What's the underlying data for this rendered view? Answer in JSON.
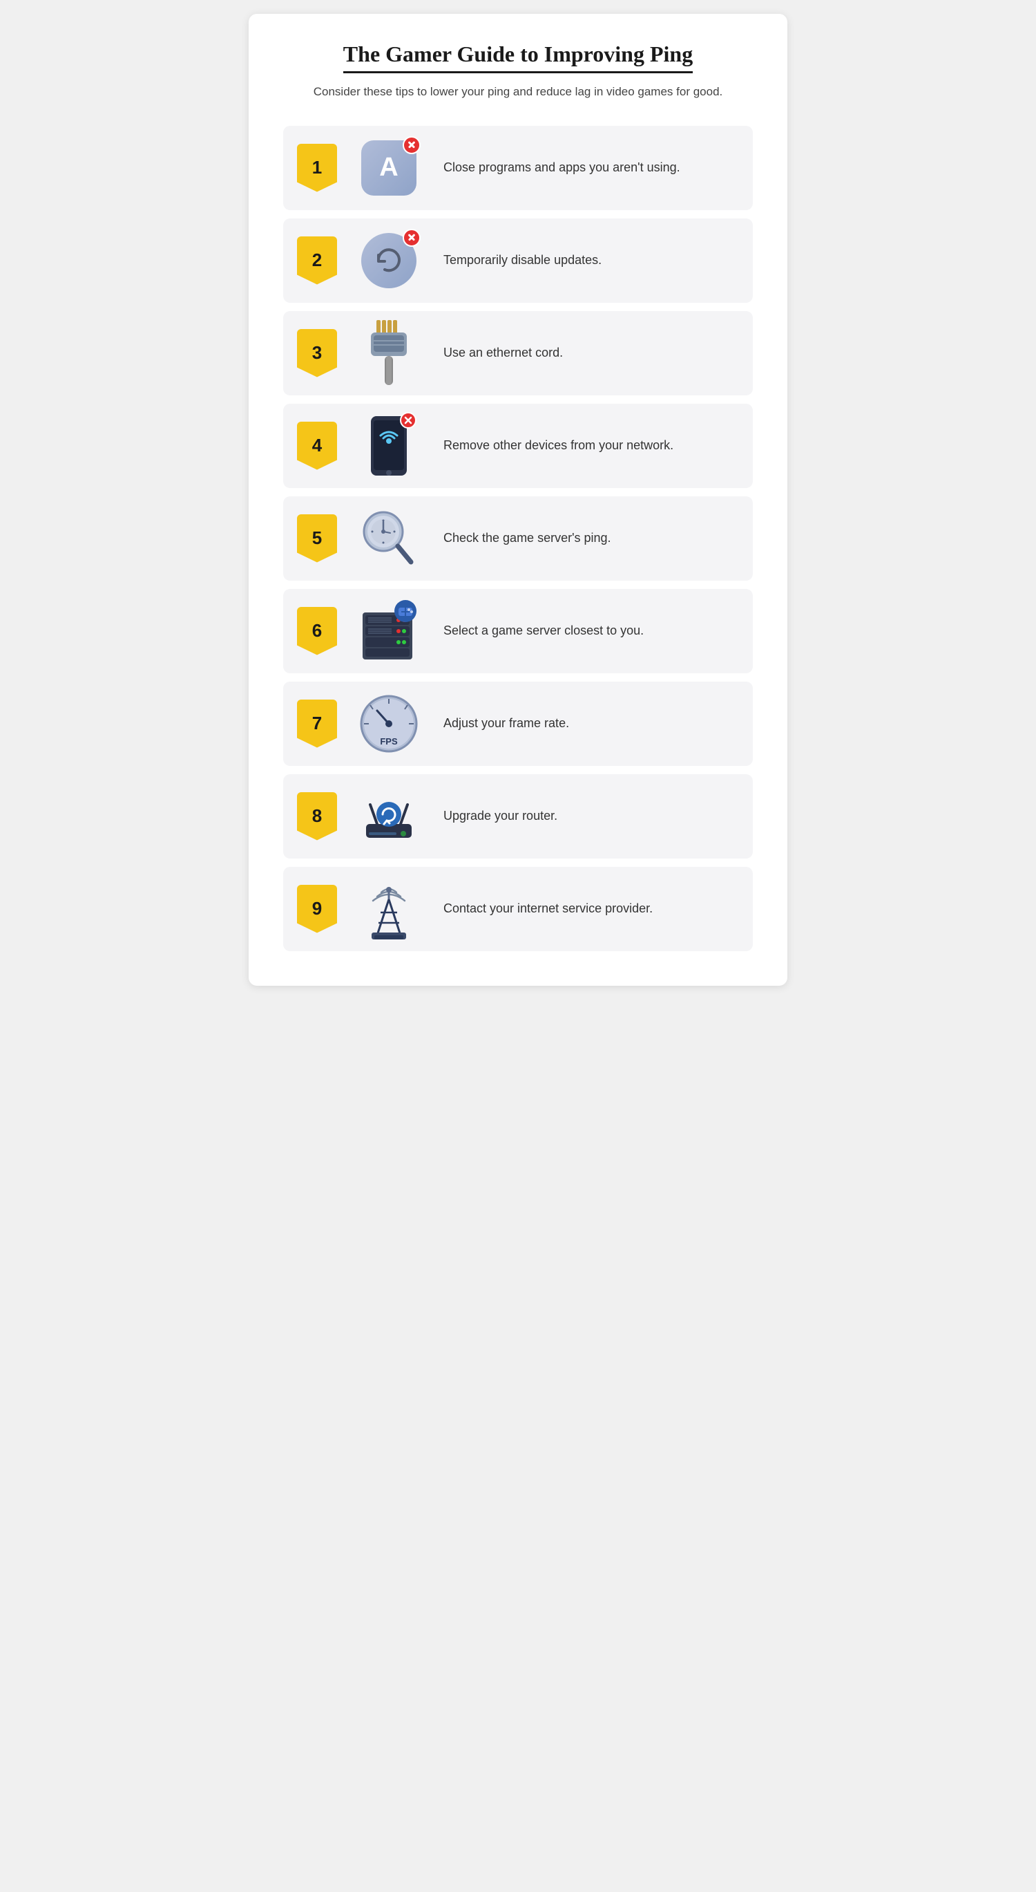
{
  "header": {
    "title": "The Gamer Guide to Improving Ping",
    "subtitle": "Consider these tips to lower your ping and reduce lag in video games for good."
  },
  "items": [
    {
      "number": "1",
      "text": "Close programs and apps you aren't using.",
      "icon_name": "app-close-icon"
    },
    {
      "number": "2",
      "text": "Temporarily disable updates.",
      "icon_name": "refresh-close-icon"
    },
    {
      "number": "3",
      "text": "Use an ethernet cord.",
      "icon_name": "ethernet-icon"
    },
    {
      "number": "4",
      "text": "Remove other devices from your network.",
      "icon_name": "phone-wifi-icon"
    },
    {
      "number": "5",
      "text": "Check the game server's ping.",
      "icon_name": "magnify-clock-icon"
    },
    {
      "number": "6",
      "text": "Select a game server closest to you.",
      "icon_name": "server-game-icon"
    },
    {
      "number": "7",
      "text": "Adjust your frame rate.",
      "icon_name": "fps-gauge-icon"
    },
    {
      "number": "8",
      "text": "Upgrade your router.",
      "icon_name": "router-icon"
    },
    {
      "number": "9",
      "text": "Contact your internet service provider.",
      "icon_name": "antenna-tower-icon"
    }
  ],
  "colors": {
    "badge_yellow": "#f5c518",
    "badge_red": "#e53030",
    "icon_blue": "#7b92b8",
    "bg_item": "#f4f4f6",
    "text_dark": "#1a1a1a"
  }
}
